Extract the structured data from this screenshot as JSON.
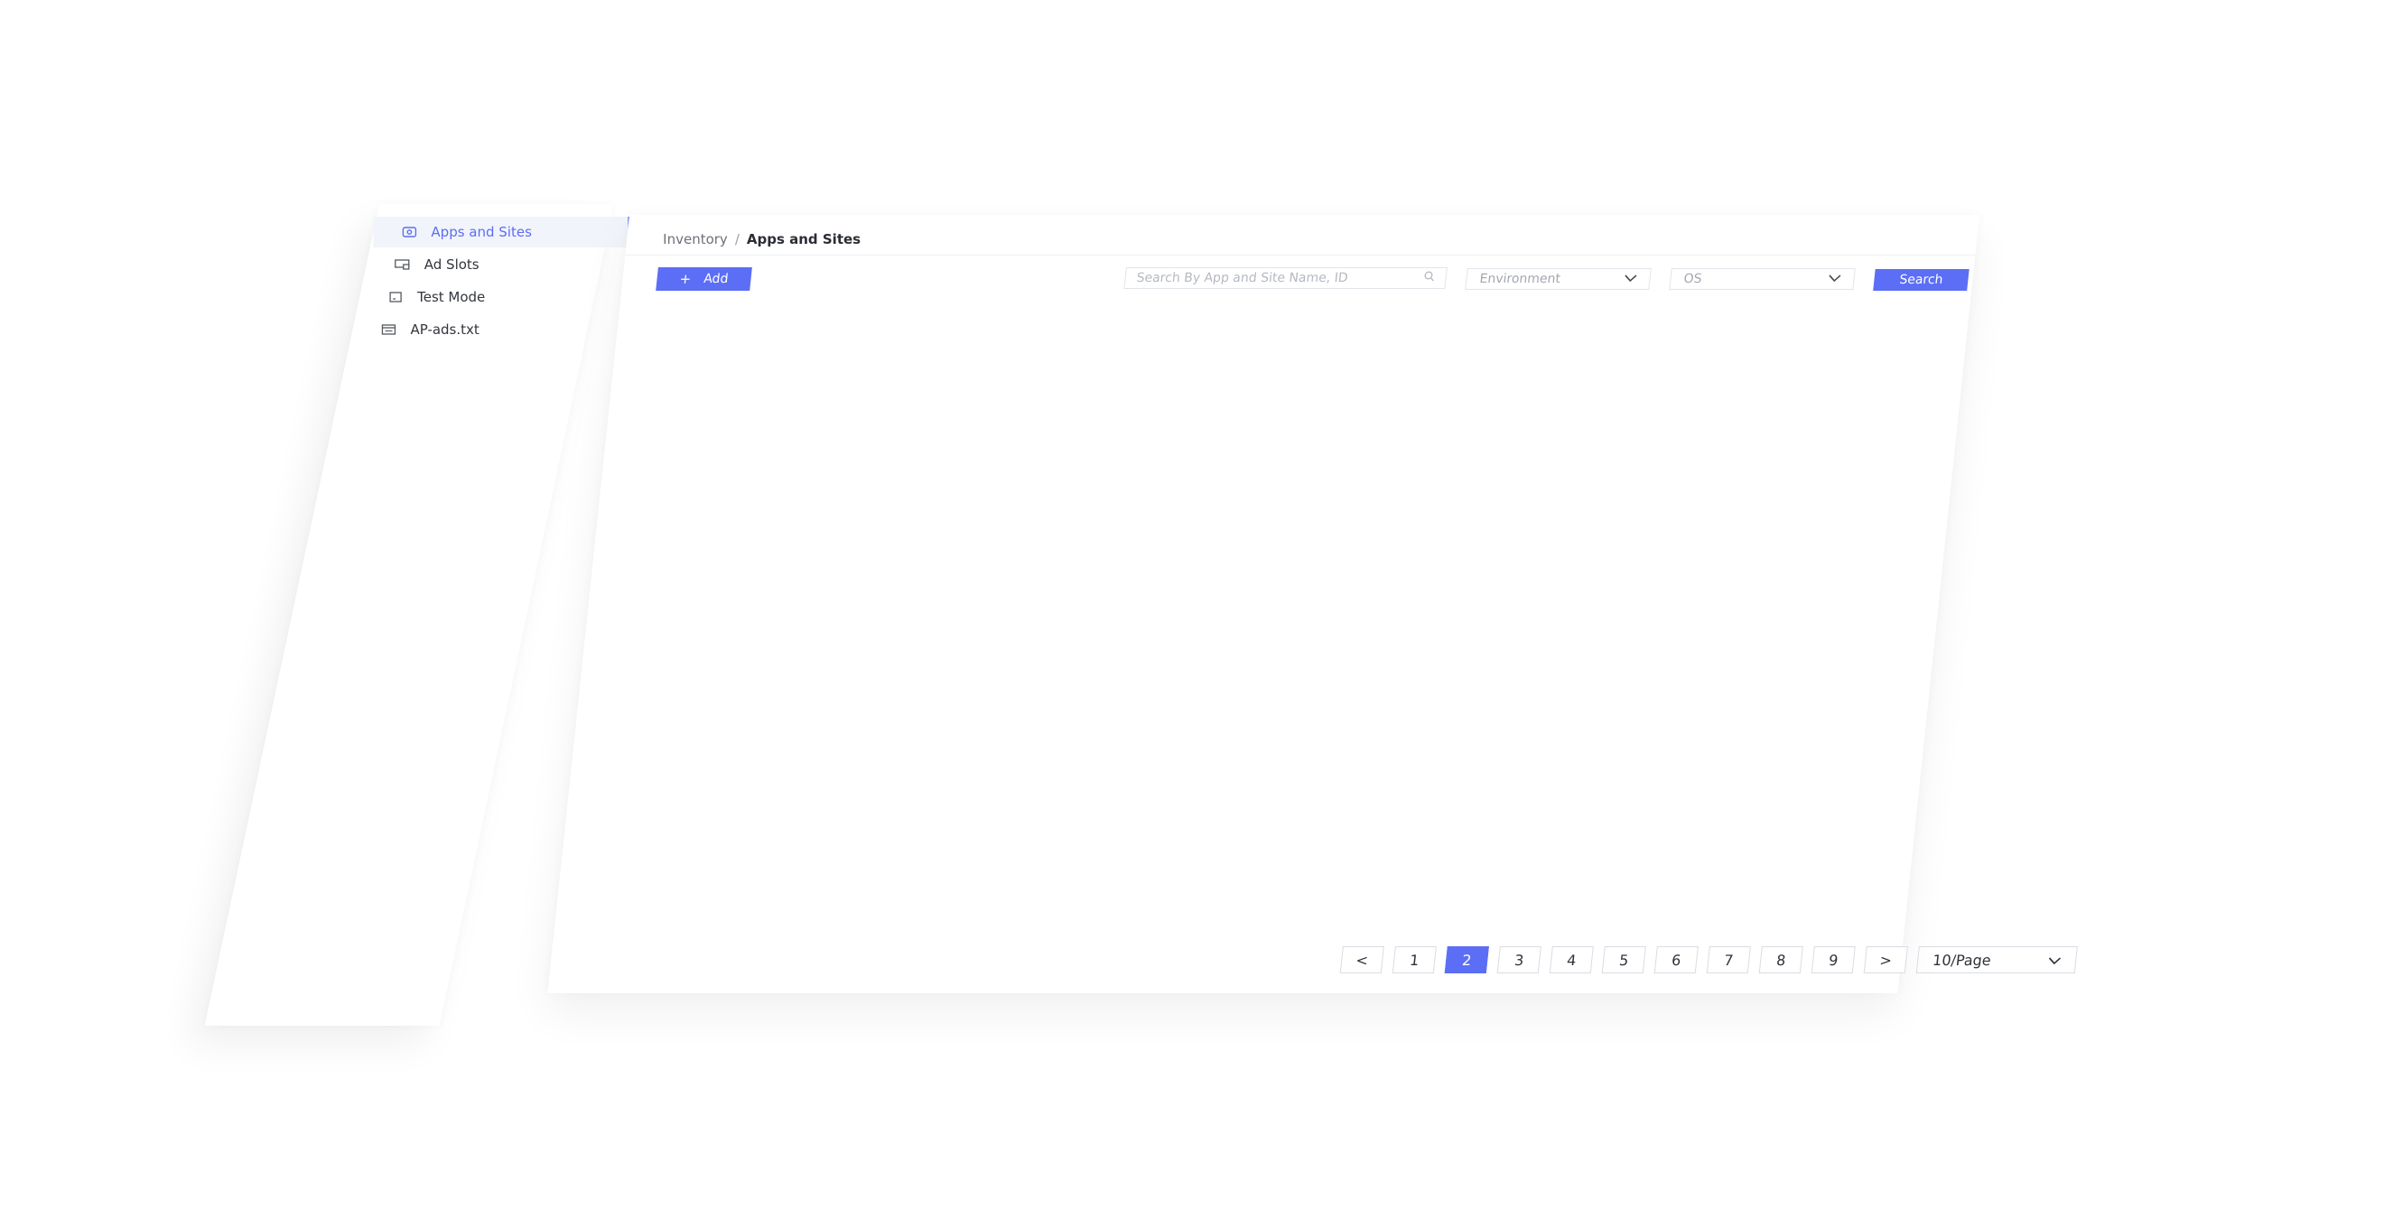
{
  "sidebar": {
    "items": [
      {
        "label": "Apps and Sites",
        "icon": "apps-icon",
        "active": true
      },
      {
        "label": "Ad Slots",
        "icon": "ad-slot-icon",
        "active": false
      },
      {
        "label": "Test Mode",
        "icon": "test-mode-icon",
        "active": false
      },
      {
        "label": "AP-ads.txt",
        "icon": "ads-txt-icon",
        "active": false
      }
    ]
  },
  "breadcrumb": {
    "parent": "Inventory",
    "separator": "/",
    "current": "Apps and Sites"
  },
  "toolbar": {
    "add_label": "Add",
    "add_icon": "plus-icon",
    "search_placeholder": "Search By App and Site Name, ID",
    "environment_value": "Environment",
    "os_value": "OS",
    "search_label": "Search"
  },
  "pagination": {
    "prev": "<",
    "next": ">",
    "pages": [
      "1",
      "2",
      "3",
      "4",
      "5",
      "6",
      "7",
      "8",
      "9"
    ],
    "current_page": "2",
    "page_size": "10/Page"
  },
  "colors": {
    "accent": "#5b6ef5",
    "text": "#2f3238",
    "muted": "#a3a7af",
    "border": "#d9dce2"
  }
}
